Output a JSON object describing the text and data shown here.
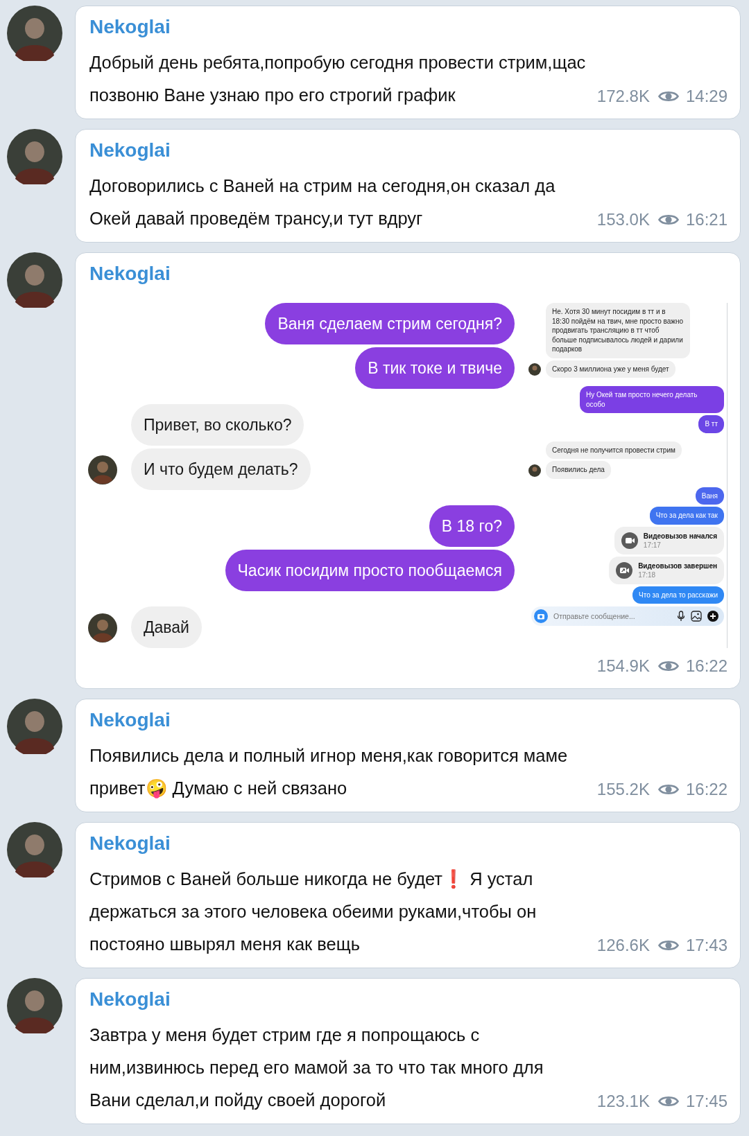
{
  "posts": [
    {
      "kind": "text",
      "author": "Nekoglai",
      "text": "Добрый день ребята,попробую сегодня провести стрим,щас позвоню Ване узнаю про его строгий график",
      "views": "172.8K",
      "time": "14:29"
    },
    {
      "kind": "text",
      "author": "Nekoglai",
      "text": "Договорились с Ваней на стрим на сегодня,он сказал да Окей давай проведём трансу,и тут вдруг",
      "views": "153.0K",
      "time": "16:21"
    },
    {
      "kind": "screenshot",
      "author": "Nekoglai",
      "views": "154.9K",
      "time": "16:22",
      "screenshot": {
        "left": [
          {
            "outgoing": true,
            "text": "Ваня сделаем стрим сегодня?"
          },
          {
            "outgoing": true,
            "text": "В тик токе и твиче"
          },
          {
            "outgoing": false,
            "text": "Привет, во сколько?"
          },
          {
            "outgoing": false,
            "text": "И что будем делать?"
          },
          {
            "outgoing": true,
            "text": "В 18 го?"
          },
          {
            "outgoing": true,
            "text": "Часик посидим просто пообщаемся"
          },
          {
            "outgoing": false,
            "text": "Давай"
          }
        ],
        "right": [
          {
            "kind": "text",
            "outgoing": false,
            "text": "Не. Хотя 30 минут посидим в тт и в 18:30 пойдём на твич, мне просто важно продвигать трансляцию в тт чтоб больше подписывалось людей и дарили подарков"
          },
          {
            "kind": "text",
            "outgoing": false,
            "text": "Скоро 3 миллиона уже у меня будет"
          },
          {
            "kind": "text",
            "outgoing": true,
            "text": "Ну Окей там просто нечего делать особо",
            "color": "#7b3fe4"
          },
          {
            "kind": "text",
            "outgoing": true,
            "text": "В тт",
            "color": "#6b46e6"
          },
          {
            "kind": "text",
            "outgoing": false,
            "text": "Сегодня не получится провести стрим"
          },
          {
            "kind": "text",
            "outgoing": false,
            "text": "Появились дела"
          },
          {
            "kind": "text",
            "outgoing": true,
            "text": "Ваня",
            "color": "#4c67ee"
          },
          {
            "kind": "text",
            "outgoing": true,
            "text": "Что за дела как так",
            "color": "#3f74f0"
          },
          {
            "kind": "call",
            "outgoing": true,
            "ended": false,
            "title": "Видеовызов начался",
            "time": "17:17"
          },
          {
            "kind": "call",
            "outgoing": true,
            "ended": true,
            "title": "Видеовызов завершен",
            "time": "17:18"
          },
          {
            "kind": "text",
            "outgoing": true,
            "text": "Что за дела то расскажи",
            "color": "#2f88f4"
          }
        ],
        "composer": {
          "placeholder": "Отправьте сообщение..."
        }
      }
    },
    {
      "kind": "text",
      "author": "Nekoglai",
      "text": "Появились дела и полный игнор меня,как говорится маме привет🤪 Думаю с ней связано",
      "views": "155.2K",
      "time": "16:22"
    },
    {
      "kind": "text",
      "author": "Nekoglai",
      "text": "Стримов с Ваней больше никогда не будет❗ Я устал держаться за этого человека обеими руками,чтобы он постояно швырял меня как вещь",
      "views": "126.6K",
      "time": "17:43"
    },
    {
      "kind": "text",
      "author": "Nekoglai",
      "text": "Завтра у меня будет стрим где я попрощаюсь с ним,извинюсь перед его мамой за то что так много для Вани сделал,и пойду своей дорогой",
      "views": "123.1K",
      "time": "17:45"
    }
  ]
}
